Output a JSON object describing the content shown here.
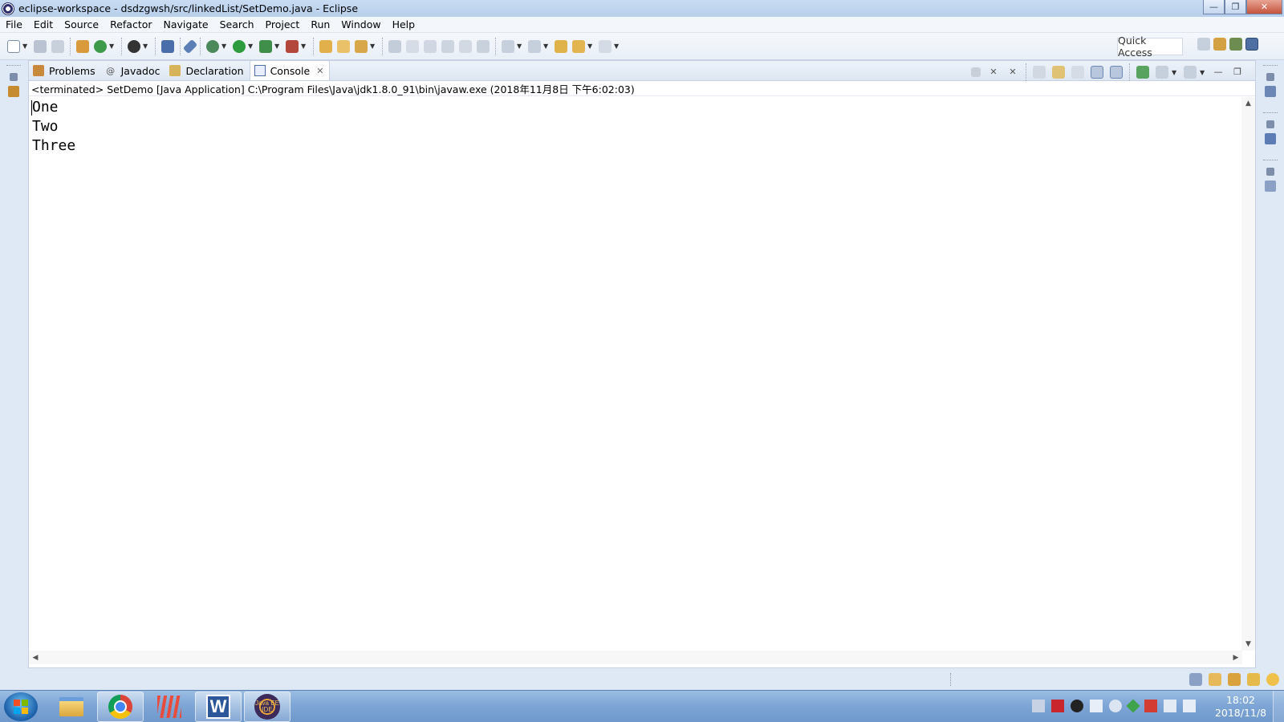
{
  "window": {
    "title": "eclipse-workspace - dsdzgwsh/src/linkedList/SetDemo.java - Eclipse",
    "minimize_glyph": "—",
    "restore_glyph": "❐",
    "close_glyph": "✕"
  },
  "menu": {
    "items": [
      "File",
      "Edit",
      "Source",
      "Refactor",
      "Navigate",
      "Search",
      "Project",
      "Run",
      "Window",
      "Help"
    ]
  },
  "toolbar": {
    "quick_access": "Quick Access"
  },
  "views": {
    "tabs": [
      {
        "label": "Problems",
        "icon": "problems-icon"
      },
      {
        "label": "Javadoc",
        "icon": "javadoc-icon"
      },
      {
        "label": "Declaration",
        "icon": "declaration-icon"
      },
      {
        "label": "Console",
        "icon": "console-icon",
        "active": true
      }
    ],
    "javadoc_glyph": "@"
  },
  "console": {
    "status": "<terminated> SetDemo [Java Application] C:\\Program Files\\Java\\jdk1.8.0_91\\bin\\javaw.exe (2018年11月8日 下午6:02:03)",
    "lines": [
      "One",
      "Two",
      "Three"
    ]
  },
  "taskbar": {
    "word_letter": "W",
    "eclipse_label": "Java EE IDE",
    "clock_time": "18:02",
    "clock_date": "2018/11/8"
  },
  "colors": {
    "accent": "#6b87b6",
    "tab_bar": "#dde6f2",
    "taskbar": "#7ea6d6"
  }
}
